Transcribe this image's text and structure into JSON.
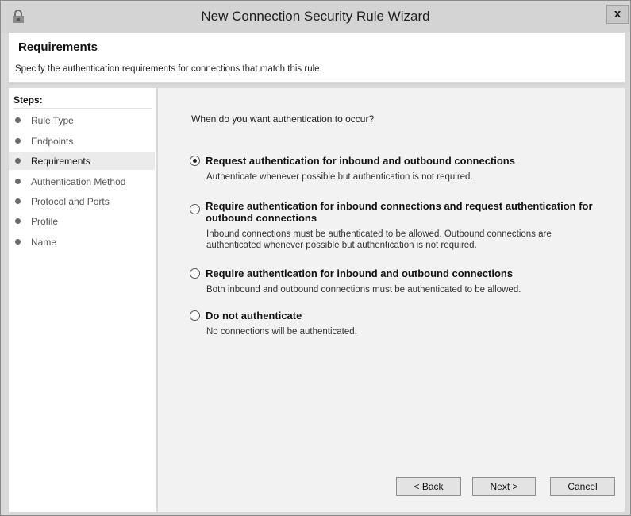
{
  "window": {
    "title": "New Connection Security Rule Wizard",
    "close_label": "x",
    "icon": "firewall-shield-icon"
  },
  "header": {
    "title": "Requirements",
    "subtitle": "Specify the authentication requirements for connections that match this rule."
  },
  "steps": {
    "title": "Steps:",
    "items": [
      {
        "label": "Rule Type",
        "active": false
      },
      {
        "label": "Endpoints",
        "active": false
      },
      {
        "label": "Requirements",
        "active": true
      },
      {
        "label": "Authentication Method",
        "active": false
      },
      {
        "label": "Protocol and Ports",
        "active": false
      },
      {
        "label": "Profile",
        "active": false
      },
      {
        "label": "Name",
        "active": false
      }
    ]
  },
  "content": {
    "question": "When do you want authentication to occur?",
    "options": [
      {
        "title": "Request authentication for inbound and outbound connections",
        "description": "Authenticate whenever possible but authentication is not required.",
        "selected": true
      },
      {
        "title": "Require authentication for inbound connections and request authentication for outbound connections",
        "description": "Inbound connections must be authenticated to be allowed. Outbound connections are authenticated whenever possible but authentication is not required.",
        "selected": false
      },
      {
        "title": "Require authentication for inbound and outbound connections",
        "description": "Both inbound and outbound connections must be authenticated to be allowed.",
        "selected": false
      },
      {
        "title": "Do not authenticate",
        "description": "No connections will be authenticated.",
        "selected": false
      }
    ]
  },
  "buttons": {
    "back": "< Back",
    "next": "Next >",
    "cancel": "Cancel"
  }
}
